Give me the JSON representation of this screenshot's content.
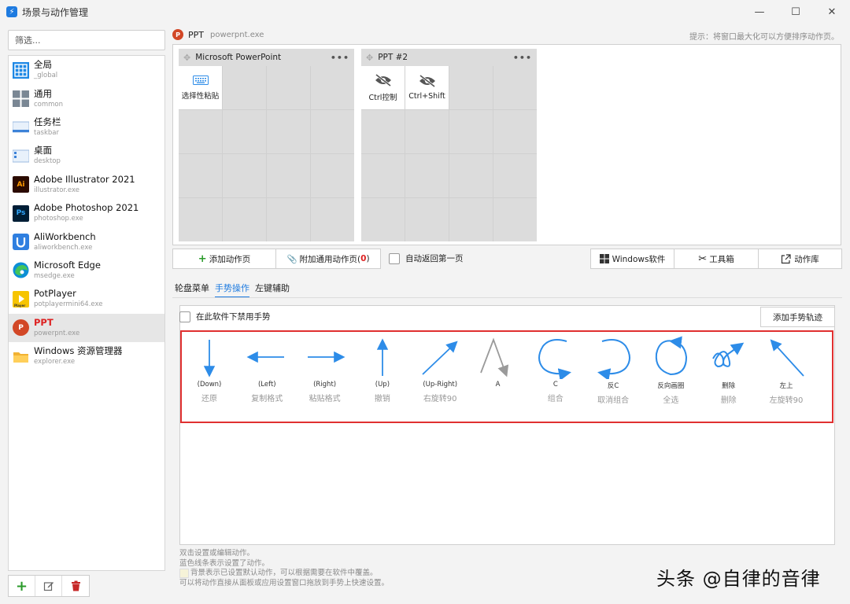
{
  "window": {
    "title": "场景与动作管理",
    "controls": {
      "minimize": "—",
      "maximize": "☐",
      "close": "✕"
    }
  },
  "sidebar": {
    "filter_placeholder": "筛选...",
    "items": [
      {
        "name": "全局",
        "exe": "_global",
        "icon": "grid-icon",
        "color": "#1e88e5"
      },
      {
        "name": "通用",
        "exe": "common",
        "icon": "tiles-icon",
        "color": "#7a8794"
      },
      {
        "name": "任务栏",
        "exe": "taskbar",
        "icon": "taskbar-icon",
        "color": "#3c82d8"
      },
      {
        "name": "桌面",
        "exe": "desktop",
        "icon": "desktop-icon",
        "color": "#3c82d8"
      },
      {
        "name": "Adobe Illustrator 2021",
        "exe": "illustrator.exe",
        "icon": "Ai",
        "color": "#2b0a00"
      },
      {
        "name": "Adobe Photoshop 2021",
        "exe": "photoshop.exe",
        "icon": "Ps",
        "color": "#001e36"
      },
      {
        "name": "AliWorkbench",
        "exe": "aliworkbench.exe",
        "icon": "aliworkbench-icon",
        "color": "#2f7fe0"
      },
      {
        "name": "Microsoft Edge",
        "exe": "msedge.exe",
        "icon": "edge-icon",
        "color": "#0c8fd6"
      },
      {
        "name": "PotPlayer",
        "exe": "potplayermini64.exe",
        "icon": "potplayer-icon",
        "color": "#f6c400"
      },
      {
        "name": "PPT",
        "exe": "powerpnt.exe",
        "icon": "P",
        "color": "#d24726",
        "selected": true
      },
      {
        "name": "Windows 资源管理器",
        "exe": "explorer.exe",
        "icon": "folder-icon",
        "color": "#f2b233"
      }
    ],
    "tools": {
      "add": "+",
      "edit": "✎",
      "delete": "🗑"
    }
  },
  "header": {
    "app_name": "PPT",
    "app_exe": "powerpnt.exe",
    "hint": "提示：将窗口最大化可以方便排序动作页。"
  },
  "pages": [
    {
      "title": "Microsoft PowerPoint",
      "menu": "•••",
      "cells": [
        {
          "label": "选择性粘贴",
          "icon": "keyboard-icon"
        }
      ]
    },
    {
      "title": "PPT #2",
      "menu": "•••",
      "cells": [
        {
          "label": "Ctrl控制",
          "icon": "eye-off-icon"
        },
        {
          "label": "Ctrl+Shift",
          "icon": "eye-off-icon"
        }
      ]
    }
  ],
  "toolbar": {
    "add_page": "添加动作页",
    "attach_general": "附加通用动作页(",
    "attach_count": "0",
    "attach_close": ")",
    "auto_return": "自动返回第一页",
    "windows_software": "Windows软件",
    "toolbox": "工具箱",
    "action_library": "动作库"
  },
  "tabs": [
    {
      "label": "轮盘菜单",
      "active": false
    },
    {
      "label": "手势操作",
      "active": true
    },
    {
      "label": "左键辅助",
      "active": false
    }
  ],
  "gesture_panel": {
    "disable_label": "在此软件下禁用手势",
    "add_button": "添加手势轨迹",
    "stroke_color": "#2d8ce8",
    "gestures": [
      {
        "name": "(Down)",
        "action": "还原",
        "shape": "down"
      },
      {
        "name": "(Left)",
        "action": "复制格式",
        "shape": "left"
      },
      {
        "name": "(Right)",
        "action": "粘贴格式",
        "shape": "right"
      },
      {
        "name": "(Up)",
        "action": "撤销",
        "shape": "up"
      },
      {
        "name": "(Up-Right)",
        "action": "右旋转90",
        "shape": "up-right"
      },
      {
        "name": "A",
        "action": "",
        "shape": "A"
      },
      {
        "name": "C",
        "action": "组合",
        "shape": "C"
      },
      {
        "name": "反C",
        "action": "取消组合",
        "shape": "reverse-C"
      },
      {
        "name": "反向画圈",
        "action": "全选",
        "shape": "circle"
      },
      {
        "name": "删除",
        "action": "删除",
        "shape": "scribble"
      },
      {
        "name": "左上",
        "action": "左旋转90",
        "shape": "up-left"
      }
    ]
  },
  "notes": [
    "双击设置或编辑动作。",
    "蓝色线条表示设置了动作。",
    "背景表示已设置默认动作，可以根据需要在软件中覆盖。",
    "可以将动作直接从面板或应用设置窗口拖放到手势上快速设置。"
  ],
  "watermark": "头条 @自律的音律"
}
